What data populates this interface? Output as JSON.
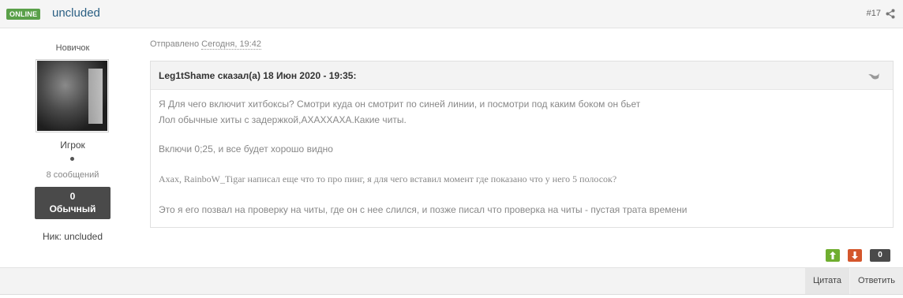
{
  "header": {
    "status_badge": "ONLINE",
    "author": "uncluded",
    "post_number": "#17"
  },
  "sidebar": {
    "rank_title": "Новичок",
    "group": "Игрок",
    "post_count": "8 сообщений",
    "reputation_value": "0",
    "reputation_label": "Обычный",
    "nick": "Ник: uncluded"
  },
  "post": {
    "posted_label": "Отправлено",
    "posted_date": "Сегодня, 19:42",
    "quote": {
      "citation": "Leg1tShame сказал(а) 18 Июн 2020 - 19:35:",
      "lines": [
        "Я Для чего включит хитбоксы? Смотри куда он смотрит по синей линии, и посмотри под каким боком он бьет",
        "Лол обычные хиты с задержкой,АХАХХАХА.Какие читы.",
        "Включи 0;25, и все будет хорошо видно",
        "Axax, RainboW_Tigar написал еще что то про пинг, я для чего вставил момент где показано что у него 5 полосок?",
        "Это я его позвал на проверку на читы, где он с нее слился, и позже писал что проверка на читы - пустая трата времени"
      ]
    }
  },
  "votes": {
    "count": "0"
  },
  "footer": {
    "quote_button": "Цитата",
    "reply_button": "Ответить"
  },
  "colors": {
    "online": "#5aa049",
    "author_link": "#2a5f83",
    "vote_up": "#6fae2f",
    "vote_down": "#d4562c",
    "reputation_bg": "#4a4a4a"
  },
  "icons": {
    "share": "share-icon",
    "quote": "quote-icon",
    "vote_up": "arrow-up-icon",
    "vote_down": "arrow-down-icon"
  }
}
